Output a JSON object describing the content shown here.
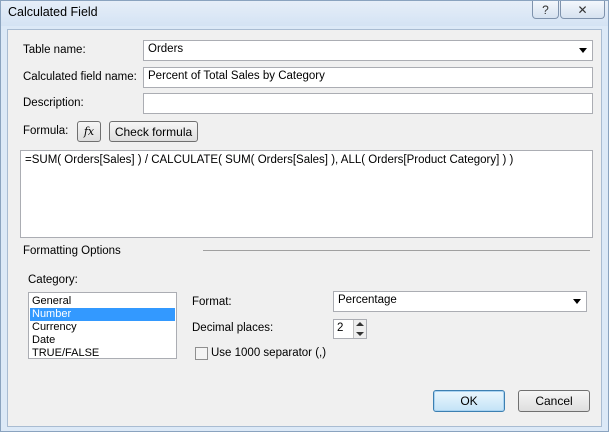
{
  "window": {
    "title": "Calculated Field",
    "help_label": "?",
    "close_label": "✕"
  },
  "fields": {
    "table_name_label": "Table name:",
    "table_name_value": "Orders",
    "calc_field_name_label": "Calculated field name:",
    "calc_field_name_value": "Percent of Total Sales by Category",
    "description_label": "Description:",
    "description_value": "",
    "formula_label": "Formula:",
    "fx_icon": "function-icon",
    "fx_glyph": "fx",
    "check_formula_label": "Check formula",
    "formula_value": "=SUM( Orders[Sales] ) / CALCULATE( SUM( Orders[Sales] ), ALL( Orders[Product Category] ) )"
  },
  "formatting": {
    "section_label": "Formatting Options",
    "category_label": "Category:",
    "categories": [
      "General",
      "Number",
      "Currency",
      "Date",
      "TRUE/FALSE"
    ],
    "selected_category": "Number",
    "format_label": "Format:",
    "format_value": "Percentage",
    "decimal_places_label": "Decimal places:",
    "decimal_places_value": "2",
    "separator_label": "Use 1000 separator (,)",
    "separator_checked": false
  },
  "buttons": {
    "ok_label": "OK",
    "cancel_label": "Cancel"
  },
  "colors": {
    "selection": "#3399ff",
    "window_frame": "#dce9f7"
  }
}
